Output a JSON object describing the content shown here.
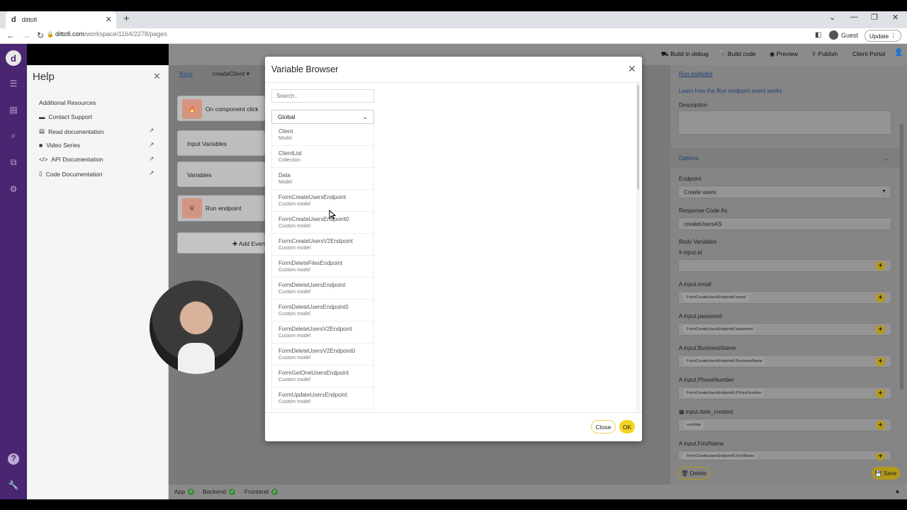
{
  "browser": {
    "tab_title": "dittofi",
    "tab_logo": "d",
    "url_host": "dittofi.com",
    "url_path": "/workspace/1164/2278/pages",
    "profile": "Guest",
    "update_label": "Update"
  },
  "sidebar": {
    "brand": "d",
    "icons": [
      "list-icon",
      "database-icon",
      "magnifier-icon",
      "layers-icon",
      "settings-icon",
      "help-icon",
      "wrench-icon"
    ]
  },
  "help": {
    "title": "Help",
    "section": "Additional Resources",
    "items": [
      {
        "label": "Contact Support",
        "icon": "chat-icon",
        "external": false
      },
      {
        "label": "Read documentation",
        "icon": "book-icon",
        "external": true
      },
      {
        "label": "Video Series",
        "icon": "video-icon",
        "external": true
      },
      {
        "label": "API Documentation",
        "icon": "code-icon",
        "external": true
      },
      {
        "label": "Code Documentation",
        "icon": "file-icon",
        "external": true
      }
    ]
  },
  "toolbar": {
    "build_debug": "Build in debug",
    "build_code": "Build code",
    "preview": "Preview",
    "publish": "Publish",
    "client_portal": "Client Portal"
  },
  "canvas": {
    "back": "Back",
    "crumb": "createClient",
    "events": {
      "on_click": "On component click",
      "input_vars": "Input Variables",
      "variables": "Variables",
      "run_endpoint": "Run endpoint",
      "run_endpoint_badge": "R"
    },
    "add_event": "Add Event"
  },
  "right": {
    "run_endpoint_link": "Run endpoint",
    "learn_prefix": "Learn how the ",
    "learn_em": "Run endpoint",
    "learn_suffix": " event works",
    "description": "Description",
    "options": "Options",
    "endpoint_label": "Endpoint",
    "endpoint_value": "Create users",
    "response_label": "Response Code As",
    "response_value": "createUsersAS",
    "body_label": "Body Variables",
    "vars": [
      {
        "type": "#",
        "name": "input.id",
        "chip": ""
      },
      {
        "type": "A",
        "name": "input.email",
        "chip": "FormCreateUsersEndpoint0.email"
      },
      {
        "type": "A",
        "name": "input.password",
        "chip": "FormCreateUsersEndpoint0.password"
      },
      {
        "type": "A",
        "name": "input.BusinessName",
        "chip": "FormCreateUsersEndpoint0.BusinessName"
      },
      {
        "type": "A",
        "name": "input.PhoneNumber",
        "chip": "FormCreateUsersEndpoint0.PhoneNumber"
      },
      {
        "type": "▦",
        "name": "input.date_created",
        "chip": "currdate"
      },
      {
        "type": "A",
        "name": "input.FirstName",
        "chip": "FormCreateUsersEndpoint0.FirstName"
      }
    ],
    "delete": "Delete",
    "save": "Save"
  },
  "status": {
    "app": "App",
    "backend": "Backend",
    "frontend": "Frontend"
  },
  "modal": {
    "title": "Variable Browser",
    "search_placeholder": "Search..",
    "scope": "Global",
    "items": [
      {
        "name": "Client",
        "type": "Model"
      },
      {
        "name": "ClientList",
        "type": "Collection"
      },
      {
        "name": "Data",
        "type": "Model"
      },
      {
        "name": "FormCreateUsersEndpoint",
        "type": "Custom model"
      },
      {
        "name": "FormCreateUsersEndpoint0",
        "type": "Custom model"
      },
      {
        "name": "FormCreateUsersV2Endpoint",
        "type": "Custom model"
      },
      {
        "name": "FormDeleteFilesEndpoint",
        "type": "Custom model"
      },
      {
        "name": "FormDeleteUsersEndpoint",
        "type": "Custom model"
      },
      {
        "name": "FormDeleteUsersEndpoint0",
        "type": "Custom model"
      },
      {
        "name": "FormDeleteUsersV2Endpoint",
        "type": "Custom model"
      },
      {
        "name": "FormDeleteUsersV2Endpoint0",
        "type": "Custom model"
      },
      {
        "name": "FormGetOneUsersEndpoint",
        "type": "Custom model"
      },
      {
        "name": "FormUpdateUsersEndpoint",
        "type": "Custom model"
      }
    ],
    "close": "Close",
    "ok": "OK"
  }
}
